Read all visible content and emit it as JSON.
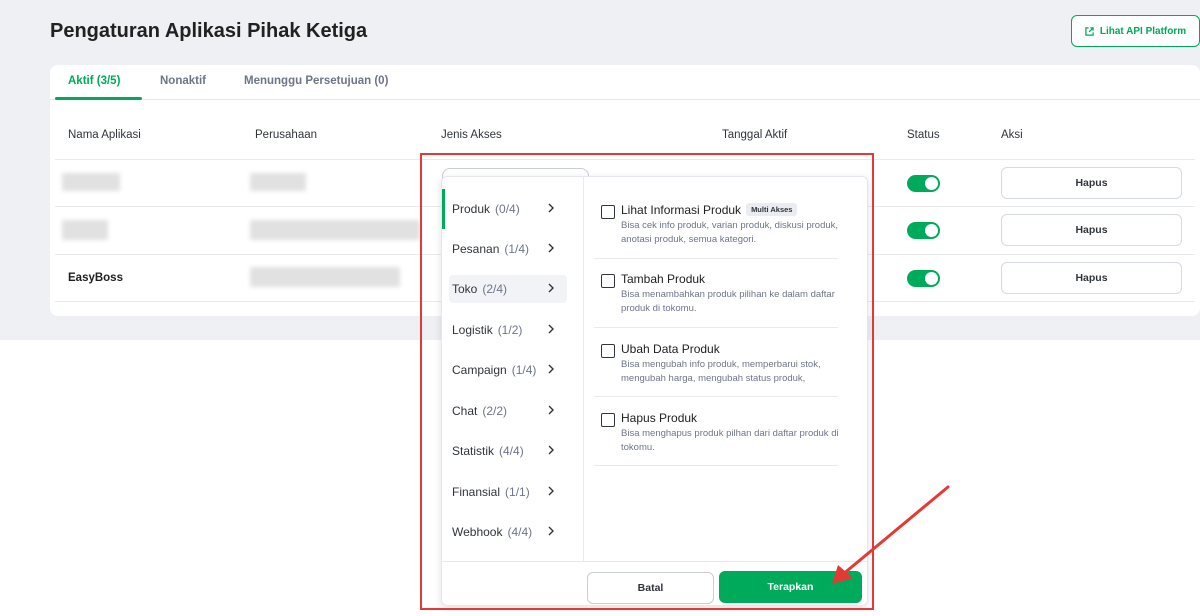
{
  "page": {
    "title": "Pengaturan Aplikasi Pihak Ketiga",
    "api_button_label": "Lihat API Platform"
  },
  "tabs": [
    {
      "label": "Aktif (3/5)"
    },
    {
      "label": "Nonaktif"
    },
    {
      "label": "Menunggu Persetujuan (0)"
    }
  ],
  "table": {
    "headers": [
      "Nama Aplikasi",
      "Perusahaan",
      "Jenis Akses",
      "Tanggal Aktif",
      "Status",
      "Aksi"
    ],
    "rows": [
      {
        "name": "",
        "status": "on",
        "action": "Hapus"
      },
      {
        "name": "",
        "status": "on",
        "action": "Hapus"
      },
      {
        "name": "EasyBoss",
        "status": "on",
        "action": "Hapus"
      }
    ]
  },
  "access_panel": {
    "categories": [
      {
        "label": "Produk",
        "count": "(0/4)"
      },
      {
        "label": "Pesanan",
        "count": "(1/4)"
      },
      {
        "label": "Toko",
        "count": "(2/4)"
      },
      {
        "label": "Logistik",
        "count": "(1/2)"
      },
      {
        "label": "Campaign",
        "count": "(1/4)"
      },
      {
        "label": "Chat",
        "count": "(2/2)"
      },
      {
        "label": "Statistik",
        "count": "(4/4)"
      },
      {
        "label": "Finansial",
        "count": "(1/1)"
      },
      {
        "label": "Webhook",
        "count": "(4/4)"
      }
    ],
    "permissions": [
      {
        "title": "Lihat Informasi Produk",
        "badge": "Multi Akses",
        "desc": "Bisa cek info produk, varian produk, diskusi produk, anotasi produk, semua kategori."
      },
      {
        "title": "Tambah Produk",
        "desc": "Bisa menambahkan produk pilihan ke dalam daftar produk di tokomu."
      },
      {
        "title": "Ubah Data Produk",
        "desc": "Bisa mengubah info produk, memperbarui stok, mengubah harga, mengubah status produk,"
      },
      {
        "title": "Hapus Produk",
        "desc": "Bisa menghapus produk pilhan dari daftar produk di tokomu."
      }
    ],
    "cancel_label": "Batal",
    "apply_label": "Terapkan"
  },
  "colors": {
    "accent": "#00aa5b",
    "highlight_box": "#e53935"
  }
}
